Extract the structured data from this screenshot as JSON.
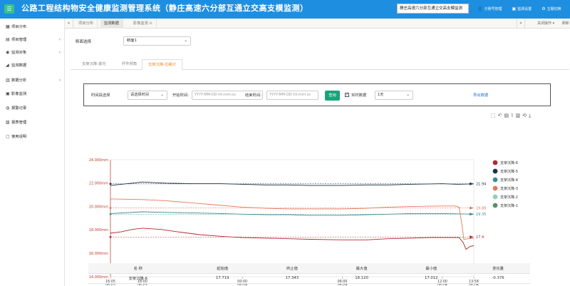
{
  "header": {
    "menu_icon": "☰",
    "title": "公路工程结构物安全健康监测管理系统（静庄高速六分部互通立交高支模监测）",
    "project_select": "静庄高速六分部互通立交高支模监测",
    "links": [
      {
        "icon": "user-icon",
        "label": "子账号管理"
      },
      {
        "icon": "monitor-icon",
        "label": "监测设置"
      },
      {
        "icon": "gear-icon",
        "label": "主题切换"
      }
    ]
  },
  "sidebar": {
    "items": [
      {
        "label": "项目分布",
        "icon": "map-icon",
        "has_children": false
      },
      {
        "label": "项目管理",
        "icon": "folder-icon",
        "has_children": true
      },
      {
        "label": "监测对象",
        "icon": "eye-icon",
        "has_children": true
      },
      {
        "label": "监测数据",
        "icon": "chart-icon",
        "has_children": false
      },
      {
        "label": "数据分析",
        "icon": "analysis-icon",
        "has_children": true
      },
      {
        "label": "影像监测",
        "icon": "camera-icon",
        "has_children": false
      },
      {
        "label": "报警记录",
        "icon": "alarm-icon",
        "has_children": false
      },
      {
        "label": "报表管理",
        "icon": "report-icon",
        "has_children": false
      },
      {
        "label": "使用说明",
        "icon": "doc-icon",
        "has_children": false
      }
    ]
  },
  "tabbar": {
    "tabs": [
      {
        "label": "项目分布",
        "active": false
      },
      {
        "label": "监测数据",
        "active": true
      },
      {
        "label": "影像监测 ⊙",
        "active": false
      }
    ],
    "close_ops": "关闭操作 ▾",
    "refresh": "刷新"
  },
  "main": {
    "section_label": "断面选择",
    "section_value": "断面1",
    "subtabs": [
      {
        "label": "支架沉降-激光",
        "active": false
      },
      {
        "label": "杆件倾角",
        "active": false
      },
      {
        "label": "支架沉降-拉绳计",
        "active": true
      }
    ],
    "query": {
      "time_label": "时间段选择",
      "time_select": "请选择时间",
      "start_label": "开始时间:",
      "start_placeholder": "YYYY-MM-DD hh:mm:ss",
      "end_label": "结束时间:",
      "end_placeholder": "YYYY-MM-DD hh:mm:ss",
      "query_button": "查询",
      "realtime_label": "实时数据",
      "realtime_checked": true,
      "range_select": "1天",
      "export": "导出数据"
    }
  },
  "chart_data": {
    "type": "line",
    "y_tick_labels": [
      "14.000mm",
      "16.000mm",
      "18.000mm",
      "20.000mm",
      "22.000mm",
      "24.000mm"
    ],
    "ylim": [
      14,
      24
    ],
    "x_ticks": [
      {
        "t": 0,
        "label": "16:05",
        "sub": "06-03"
      },
      {
        "t": 115,
        "label": "18:00",
        "sub": "06-03"
      },
      {
        "t": 475,
        "label": "00:00",
        "sub": "06-04"
      },
      {
        "t": 835,
        "label": "06:00",
        "sub": "06-04"
      },
      {
        "t": 1195,
        "label": "12:00",
        "sub": "06-04"
      },
      {
        "t": 1308,
        "label": "13:58",
        "sub": "06-04"
      }
    ],
    "xlim": [
      0,
      1308
    ],
    "series": [
      {
        "name": "支架沉降-6",
        "color": "#b5252e",
        "points": [
          [
            0,
            17.72
          ],
          [
            40,
            17.85
          ],
          [
            80,
            18.05
          ],
          [
            115,
            18.15
          ],
          [
            180,
            18.05
          ],
          [
            240,
            17.85
          ],
          [
            320,
            17.6
          ],
          [
            400,
            17.45
          ],
          [
            475,
            17.35
          ],
          [
            560,
            17.3
          ],
          [
            640,
            17.25
          ],
          [
            720,
            17.2
          ],
          [
            835,
            17.15
          ],
          [
            920,
            17.15
          ],
          [
            1000,
            17.25
          ],
          [
            1080,
            17.3
          ],
          [
            1150,
            17.35
          ],
          [
            1195,
            17.35
          ],
          [
            1230,
            17.35
          ],
          [
            1255,
            17.35
          ],
          [
            1270,
            16.9
          ],
          [
            1280,
            16.35
          ],
          [
            1295,
            16.6
          ],
          [
            1308,
            16.65
          ]
        ],
        "end_label": "17.4",
        "ref": 17.4
      },
      {
        "name": "支架沉降-5",
        "color": "#1f3442",
        "points": [
          [
            0,
            21.8
          ],
          [
            60,
            21.95
          ],
          [
            115,
            22.1
          ],
          [
            200,
            22.0
          ],
          [
            300,
            21.95
          ],
          [
            400,
            21.95
          ],
          [
            475,
            21.9
          ],
          [
            560,
            21.85
          ],
          [
            640,
            21.85
          ],
          [
            720,
            21.8
          ],
          [
            835,
            21.8
          ],
          [
            920,
            21.85
          ],
          [
            1000,
            21.85
          ],
          [
            1080,
            21.9
          ],
          [
            1195,
            21.95
          ],
          [
            1250,
            21.9
          ],
          [
            1308,
            21.94
          ]
        ],
        "end_label": "21.94",
        "ref": 21.94
      },
      {
        "name": "支架沉降-4",
        "color": "#3f8c8e",
        "points": [
          [
            0,
            19.4
          ],
          [
            115,
            19.55
          ],
          [
            200,
            19.5
          ],
          [
            300,
            19.45
          ],
          [
            400,
            19.4
          ],
          [
            475,
            19.35
          ],
          [
            560,
            19.3
          ],
          [
            640,
            19.3
          ],
          [
            720,
            19.25
          ],
          [
            835,
            19.25
          ],
          [
            920,
            19.3
          ],
          [
            1000,
            19.35
          ],
          [
            1080,
            19.4
          ],
          [
            1195,
            19.4
          ],
          [
            1308,
            19.35
          ]
        ],
        "end_label": "19.35",
        "ref": 19.35
      },
      {
        "name": "支架沉降-3",
        "color": "#e07a5a",
        "points": [
          [
            0,
            20.65
          ],
          [
            115,
            20.6
          ],
          [
            200,
            20.5
          ],
          [
            300,
            20.3
          ],
          [
            400,
            20.1
          ],
          [
            475,
            19.95
          ],
          [
            560,
            19.85
          ],
          [
            640,
            19.8
          ],
          [
            720,
            19.8
          ],
          [
            835,
            19.8
          ],
          [
            920,
            19.85
          ],
          [
            1000,
            19.95
          ],
          [
            1080,
            20.0
          ],
          [
            1195,
            20.05
          ],
          [
            1240,
            20.05
          ],
          [
            1255,
            19.95
          ],
          [
            1265,
            18.5
          ],
          [
            1272,
            17.2
          ],
          [
            1308,
            17.3
          ]
        ],
        "end_label": "19.88",
        "ref": 19.88
      },
      {
        "name": "支架沉降-2",
        "color": "#8fd1b4",
        "points": [],
        "end_label": "",
        "ref": null
      },
      {
        "name": "支架沉降-1",
        "color": "#5b8f6a",
        "points": [],
        "end_label": "",
        "ref": null
      }
    ]
  },
  "stats_table": {
    "headers": [
      "名 称",
      "起始值",
      "终止值",
      "最大值",
      "最小值",
      "变化量"
    ],
    "rows": [
      [
        "支架沉降-6",
        "17.719",
        "17.343",
        "18.120",
        "17.012",
        "-0.376"
      ]
    ]
  }
}
